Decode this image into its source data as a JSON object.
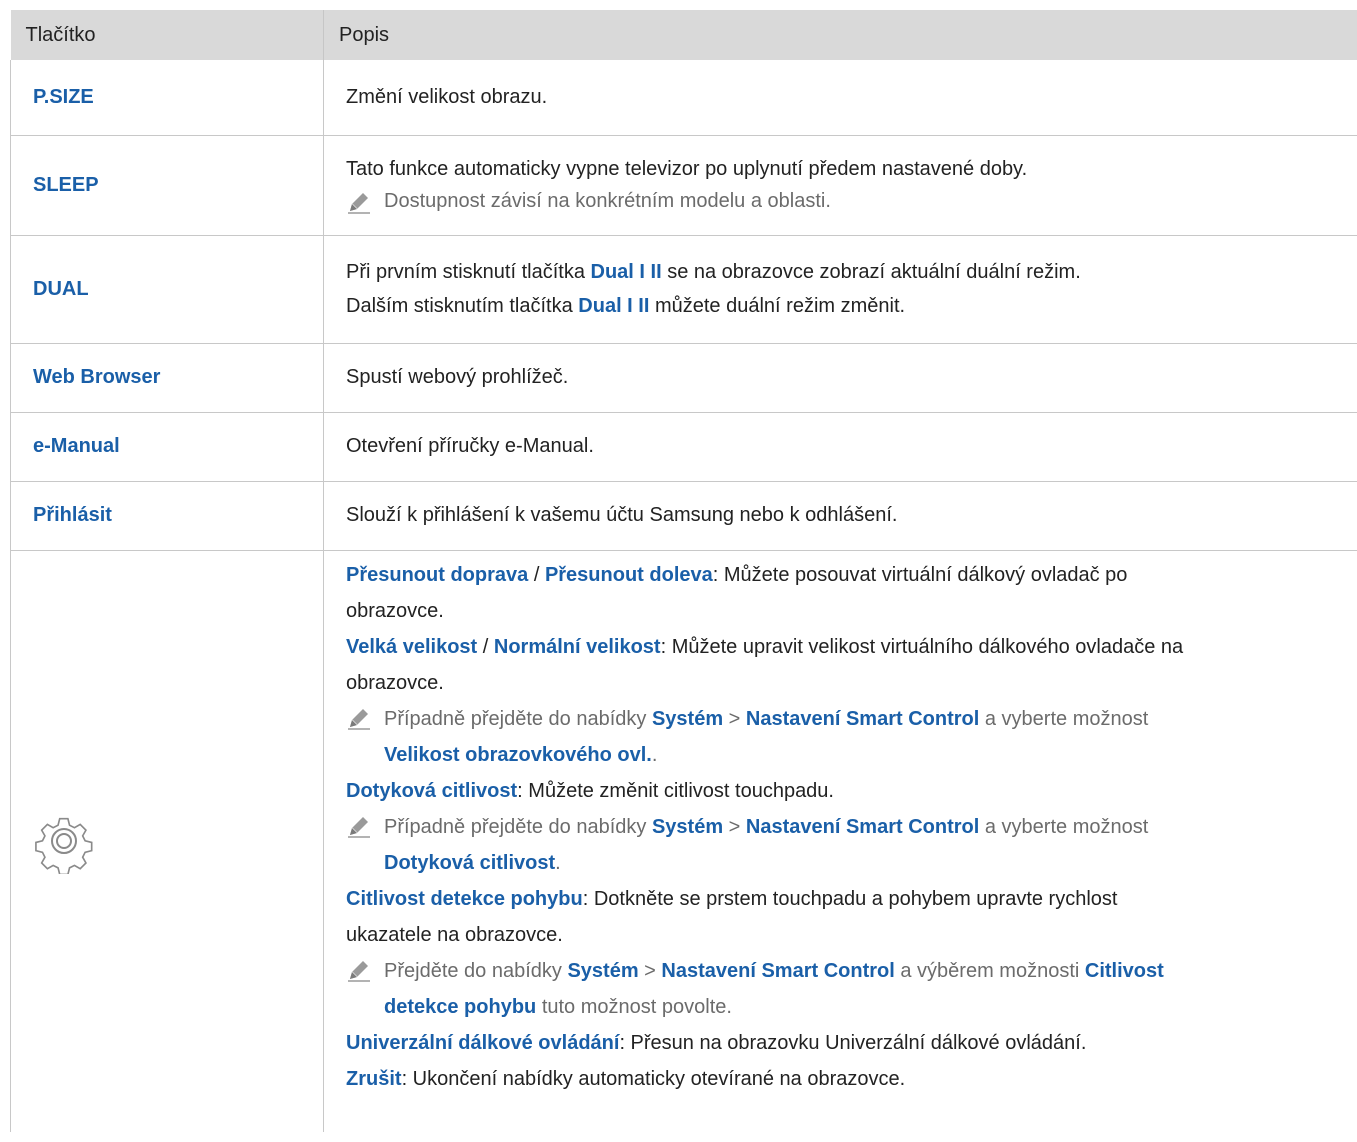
{
  "header": {
    "col1": "Tlačítko",
    "col2": "Popis"
  },
  "rows": [
    {
      "button": "P.SIZE",
      "desc": "Změní velikost obrazu."
    },
    {
      "button": "SLEEP",
      "desc": "Tato funkce automaticky vypne televizor po uplynutí předem nastavené doby.",
      "note": "Dostupnost závisí na konkrétním modelu a oblasti."
    },
    {
      "button": "DUAL",
      "l1a": "Při prvním stisknutí tlačítka ",
      "l1b": "Dual I II",
      "l1c": " se na obrazovce zobrazí aktuální duální režim.",
      "l2a": "Dalším stisknutím tlačítka ",
      "l2b": "Dual I II",
      "l2c": " můžete duální režim změnit."
    },
    {
      "button": "Web Browser",
      "desc": "Spustí webový prohlížeč."
    },
    {
      "button": "e-Manual",
      "desc": "Otevření příručky e-Manual."
    },
    {
      "button": "Přihlásit",
      "desc": "Slouží k přihlášení k vašemu účtu Samsung nebo k odhlášení."
    }
  ],
  "settings": {
    "icon": "gear-icon",
    "p1": {
      "a": "Přesunout doprava",
      "sep": " / ",
      "b": "Přesunout doleva",
      "rest": ": Můžete posouvat virtuální dálkový ovladač po",
      "cont": "obrazovce."
    },
    "p2": {
      "a": "Velká velikost",
      "sep": " / ",
      "b": "Normální velikost",
      "rest": ": Můžete upravit velikost virtuálního dálkového ovladače na",
      "cont": "obrazovce."
    },
    "n1": {
      "t1": "Případně přejděte do nabídky ",
      "b1": "Systém",
      "t2": " > ",
      "b2": "Nastavení Smart Control",
      "t3": " a vyberte možnost",
      "b3": "Velikost obrazovkového ovl.",
      "t4": "."
    },
    "p3": {
      "a": "Dotyková citlivost",
      "rest": ": Můžete změnit citlivost touchpadu."
    },
    "n2": {
      "t1": "Případně přejděte do nabídky ",
      "b1": "Systém",
      "t2": " > ",
      "b2": "Nastavení Smart Control",
      "t3": " a vyberte možnost",
      "b3": "Dotyková citlivost",
      "t4": "."
    },
    "p4": {
      "a": "Citlivost detekce pohybu",
      "rest": ": Dotkněte se prstem touchpadu a pohybem upravte rychlost",
      "cont": "ukazatele na obrazovce."
    },
    "n3": {
      "t1": "Přejděte do nabídky ",
      "b1": "Systém",
      "t2": " > ",
      "b2": "Nastavení Smart Control",
      "t3": " a výběrem možnosti ",
      "b3": "Citlivost",
      "b4": "detekce pohybu",
      "t4": " tuto možnost povolte."
    },
    "p5": {
      "a": "Univerzální dálkové ovládání",
      "rest": ": Přesun na obrazovku Univerzální dálkové ovládání."
    },
    "p6": {
      "a": "Zrušit",
      "rest": ": Ukončení nabídky automaticky otevírané na obrazovce."
    }
  },
  "colors": {
    "accent": "#1a5fa8",
    "header_bg": "#d9d9d9",
    "note_text": "#6b6b6b"
  }
}
